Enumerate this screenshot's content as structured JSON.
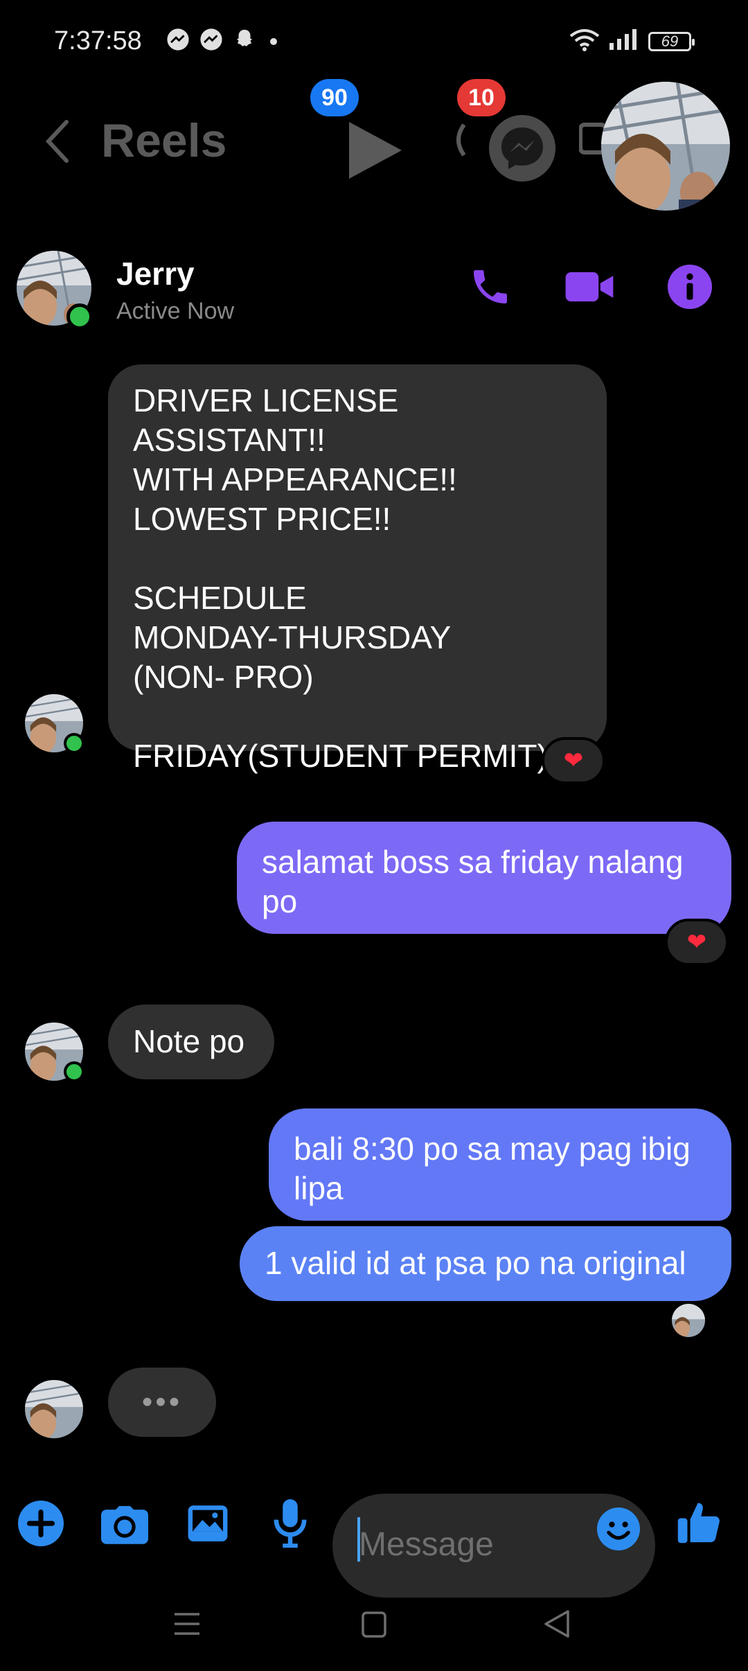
{
  "status_bar": {
    "time": "7:37:58",
    "battery": "69"
  },
  "reels_header": {
    "title": "Reels",
    "video_badge": "90",
    "messenger_badge": "10"
  },
  "chat_header": {
    "name": "Jerry",
    "status": "Active Now"
  },
  "messages": [
    {
      "from": "them",
      "lines": [
        "DRIVER LICENSE ASSISTANT!!",
        "WITH APPEARANCE!!",
        "LOWEST PRICE!!",
        "",
        "SCHEDULE",
        "MONDAY-THURSDAY",
        "(NON- PRO)",
        "",
        "FRIDAY(STUDENT PERMIT)"
      ],
      "reaction": "❤"
    },
    {
      "from": "me",
      "lines": [
        "salamat boss sa friday nalang",
        "po"
      ],
      "reaction": "❤"
    },
    {
      "from": "them",
      "lines": [
        "Note po"
      ]
    },
    {
      "from": "me",
      "lines": [
        "bali 8:30 po sa may pag ibig",
        "lipa"
      ]
    },
    {
      "from": "me",
      "lines": [
        "1 valid id at psa po na original"
      ]
    }
  ],
  "typing_indicator": "•••",
  "composer": {
    "placeholder": "Message"
  },
  "colors": {
    "accent": "#8b45f0",
    "outgoing_top": "#7c6af6",
    "outgoing_bottom": "#5b82f5",
    "incoming": "#303030",
    "composer_icons": "#2d8cf0"
  }
}
